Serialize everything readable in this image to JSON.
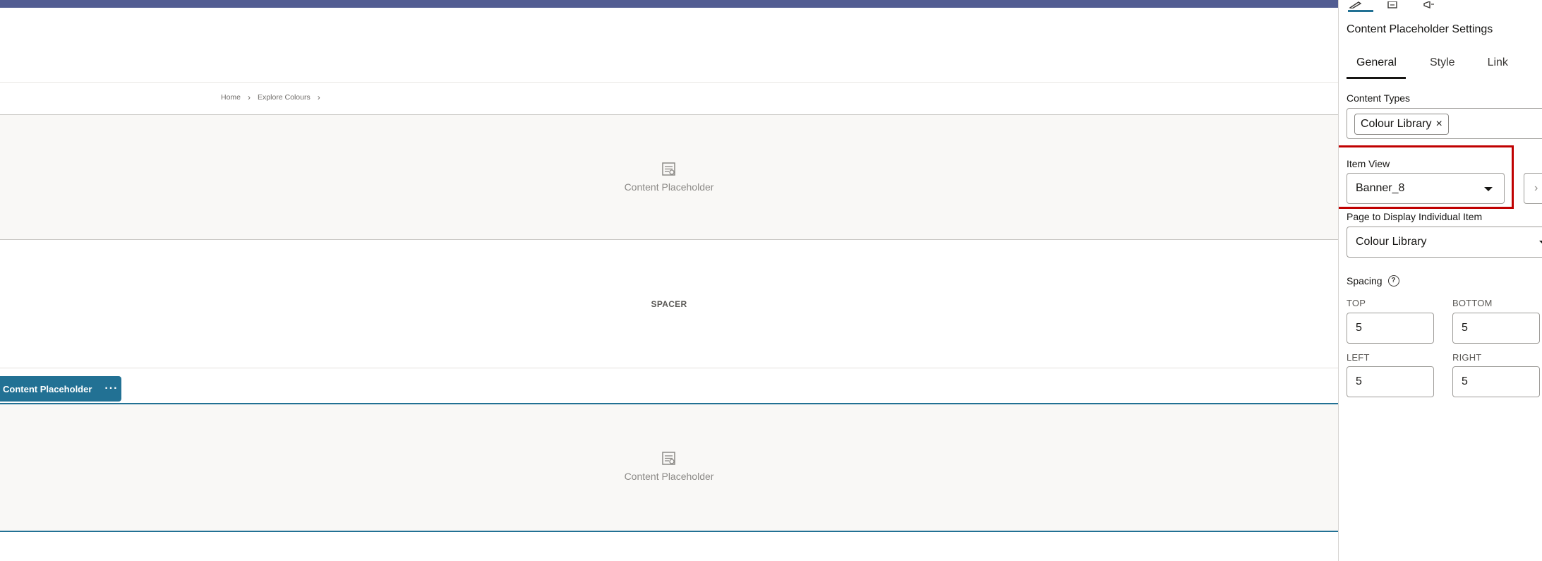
{
  "canvas": {
    "breadcrumb": [
      "Home",
      "Explore Colours"
    ],
    "placeholder_label_1": "Content Placeholder",
    "spacer_label": "SPACER",
    "toolbar": {
      "label": "Content Placeholder",
      "more": "···"
    },
    "placeholder_label_2": "Content Placeholder",
    "accent_color": "#227194",
    "topbar_color": "#525d92"
  },
  "panel": {
    "title": "Content Placeholder Settings",
    "tabs": [
      {
        "label": "General",
        "active": true
      },
      {
        "label": "Style",
        "active": false
      },
      {
        "label": "Link",
        "active": false
      }
    ],
    "content_types": {
      "label": "Content Types",
      "chips": [
        "Colour Library"
      ]
    },
    "item_view": {
      "label": "Item View",
      "value": "Banner_8",
      "highlight_color": "#c00000"
    },
    "page_display": {
      "label": "Page to Display Individual Item",
      "value": "Colour Library"
    },
    "spacing": {
      "label": "Spacing",
      "top_label": "TOP",
      "top": "5",
      "bottom_label": "BOTTOM",
      "bottom": "5",
      "left_label": "LEFT",
      "left": "5",
      "right_label": "RIGHT",
      "right": "5"
    }
  }
}
